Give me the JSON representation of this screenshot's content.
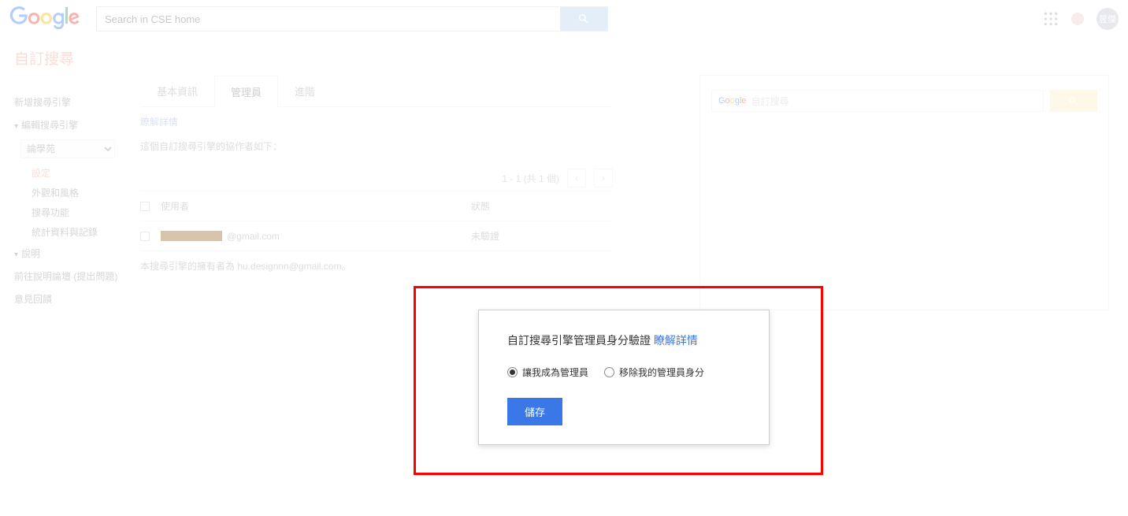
{
  "header": {
    "search_placeholder": "Search in CSE home",
    "avatar_text": "昱傑"
  },
  "section_title": "自訂搜尋",
  "sidebar": {
    "new_engine": "新增搜尋引擎",
    "edit_engine": "編輯搜尋引擎",
    "select_value": "論學苑",
    "sub": {
      "settings": "設定",
      "look": "外觀和風格",
      "features": "搜尋功能",
      "stats": "統計資料與記錄"
    },
    "help": "說明",
    "forum": "前往說明論壇 (提出問題)",
    "feedback": "意見回饋"
  },
  "tabs": {
    "basic": "基本資訊",
    "admin": "管理員",
    "advanced": "進階"
  },
  "panel": {
    "learn_more": "瞭解詳情",
    "desc": "這個自訂搜尋引擎的協作者如下：",
    "pager_text": "1 - 1 (共 1 個)",
    "col_user": "使用者",
    "col_status": "狀態",
    "row_email_suffix": "@gmail.com",
    "row_status": "未驗證",
    "owner_prefix": "本搜尋引擎的擁有者為 ",
    "owner_email": "hu.designnn@gmail.com",
    "owner_suffix": "。"
  },
  "preview": {
    "label": "自訂搜尋"
  },
  "dialog": {
    "title_prefix": "自訂搜尋引擎管理員身分驗證 ",
    "learn_more": "瞭解詳情",
    "option_make_admin": "讓我成為管理員",
    "option_remove_admin": "移除我的管理員身分",
    "save": "儲存"
  }
}
